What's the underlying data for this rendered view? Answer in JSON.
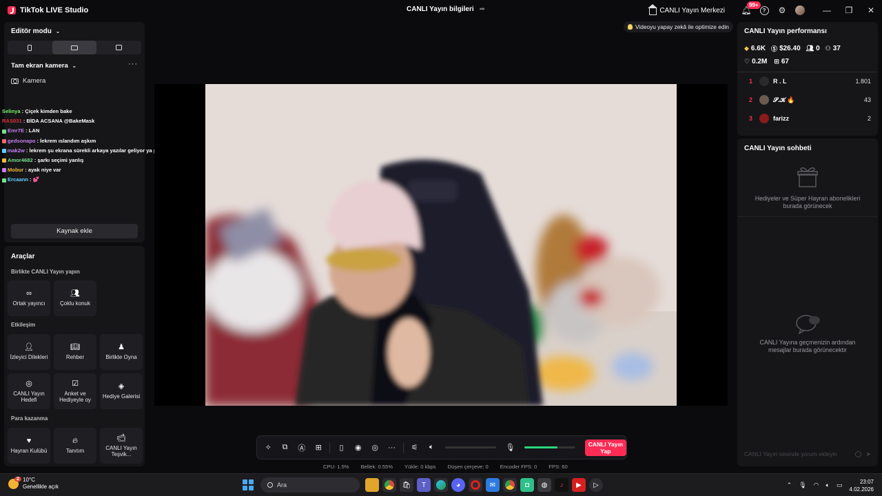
{
  "app": {
    "name": "TikTok LIVE Studio",
    "center_title": "CANLI Yayın bilgileri",
    "live_center": "CANLI Yayın Merkezi",
    "notification_badge": "99+"
  },
  "left": {
    "editor_mode": "Editör modu",
    "layout_modes": [
      "portrait",
      "landscape",
      "rotate"
    ],
    "active_mode": "landscape",
    "scene_name": "Tam ekran kamera",
    "source_camera": "Kamera",
    "add_source": "Kaynak ekle"
  },
  "chat_overlay": [
    {
      "name": "Selinya",
      "color": "#7cf36b",
      "message": ": Çiçek kimden bake"
    },
    {
      "name": "RAS031",
      "color": "#e0323a",
      "message": ": BİDA ACSANA @BakeMask"
    },
    {
      "name": "Emr7E",
      "color": "#c77ef2",
      "message": ": LAN"
    },
    {
      "name": "gedsonapo",
      "color": "#c77ef2",
      "message": ": İekrem ıslandım aşkım"
    },
    {
      "name": "mak2w",
      "color": "#c77ef2",
      "message": ": İekrem şu ekrana sürekli arkaya yazılar geliyor ya patlıyorum kopartsyor"
    },
    {
      "name": "Amor4682",
      "color": "#74e08a",
      "message": ": şarkı seçimi yanlış"
    },
    {
      "name": "Mobur",
      "color": "#f0b93a",
      "message": ": ayak niye var"
    },
    {
      "name": "Ercaann",
      "color": "#5fd0ff",
      "message": ": 💕"
    }
  ],
  "tools": {
    "title": "Araçlar",
    "sections": [
      {
        "title": "Birlikte CANLI Yayın yapın",
        "items": [
          {
            "label": "Ortak yayıncı",
            "icon": "link-icon"
          },
          {
            "label": "Çoklu konuk",
            "icon": "guests-icon"
          }
        ]
      },
      {
        "title": "Etkileşim",
        "items": [
          {
            "label": "İzleyici Dilekleri",
            "icon": "wishes-icon"
          },
          {
            "label": "Rehber",
            "icon": "guide-icon"
          },
          {
            "label": "Birlikte Oyna",
            "icon": "play-together-icon"
          },
          {
            "label": "CANLI Yayın Hedefi",
            "icon": "goal-icon"
          },
          {
            "label": "Anket ve Hediyeyle oy",
            "icon": "poll-icon"
          },
          {
            "label": "Hediye Galerisi",
            "icon": "gift-gallery-icon"
          }
        ]
      },
      {
        "title": "Para kazanma",
        "items": [
          {
            "label": "Hayran Kulübü",
            "icon": "heart-icon"
          },
          {
            "label": "Tanıtım",
            "icon": "flame-icon"
          },
          {
            "label": "CANLI Yayın Teşvik...",
            "icon": "video-icon"
          }
        ]
      }
    ]
  },
  "video": {
    "optimize_hint": "Videoyu yapay zekâ ile optimize edin"
  },
  "controls": {
    "go_live": "CANLI Yayın Yap",
    "volume_level": 0,
    "mic_level": 0.65
  },
  "status": {
    "cpu": "CPU:  1.5%",
    "memory": "Bellek:  0.55%",
    "upload": "Yükle:  0 kbps",
    "dropped": "Düşen çerçeve:  0",
    "encoder_fps": "Encoder FPS:  0",
    "fps": "FPS:  60"
  },
  "performance": {
    "title": "CANLI Yayın performansı",
    "diamonds": "6.6K",
    "earnings": "$26.40",
    "viewers": "0",
    "new_followers": "37",
    "likes": "0.2M",
    "gifts": "67",
    "ranking": [
      {
        "rank": "1",
        "name": "R . L",
        "value": "1.801",
        "avatar_color": "#2a2a2a"
      },
      {
        "rank": "2",
        "name": "𝓢.𝓚 🔥",
        "value": "43",
        "avatar_color": "#6b5b4e"
      },
      {
        "rank": "3",
        "name": "farizz",
        "value": "2",
        "avatar_color": "#8b1a1a"
      }
    ]
  },
  "live_chat": {
    "title": "CANLI Yayın sohbeti",
    "gifts_empty": "Hediyeler ve Süper Hayran abonelikleri burada görünecek",
    "messages_empty": "CANLI Yayına geçmenizin ardından mesajlar burada görünecektir",
    "input_placeholder": "CANLI Yayın sesinde yorum ekleyin"
  },
  "taskbar": {
    "temperature": "10°C",
    "weather": "Genellikle açık",
    "weather_badge": "2",
    "search_placeholder": "Ara",
    "time": "23:07",
    "date": "4.02.2026"
  },
  "colors": {
    "accent": "#fe2c55",
    "mic_level": "#2bd67b",
    "panel": "#161619",
    "background": "#0b0b0d"
  }
}
